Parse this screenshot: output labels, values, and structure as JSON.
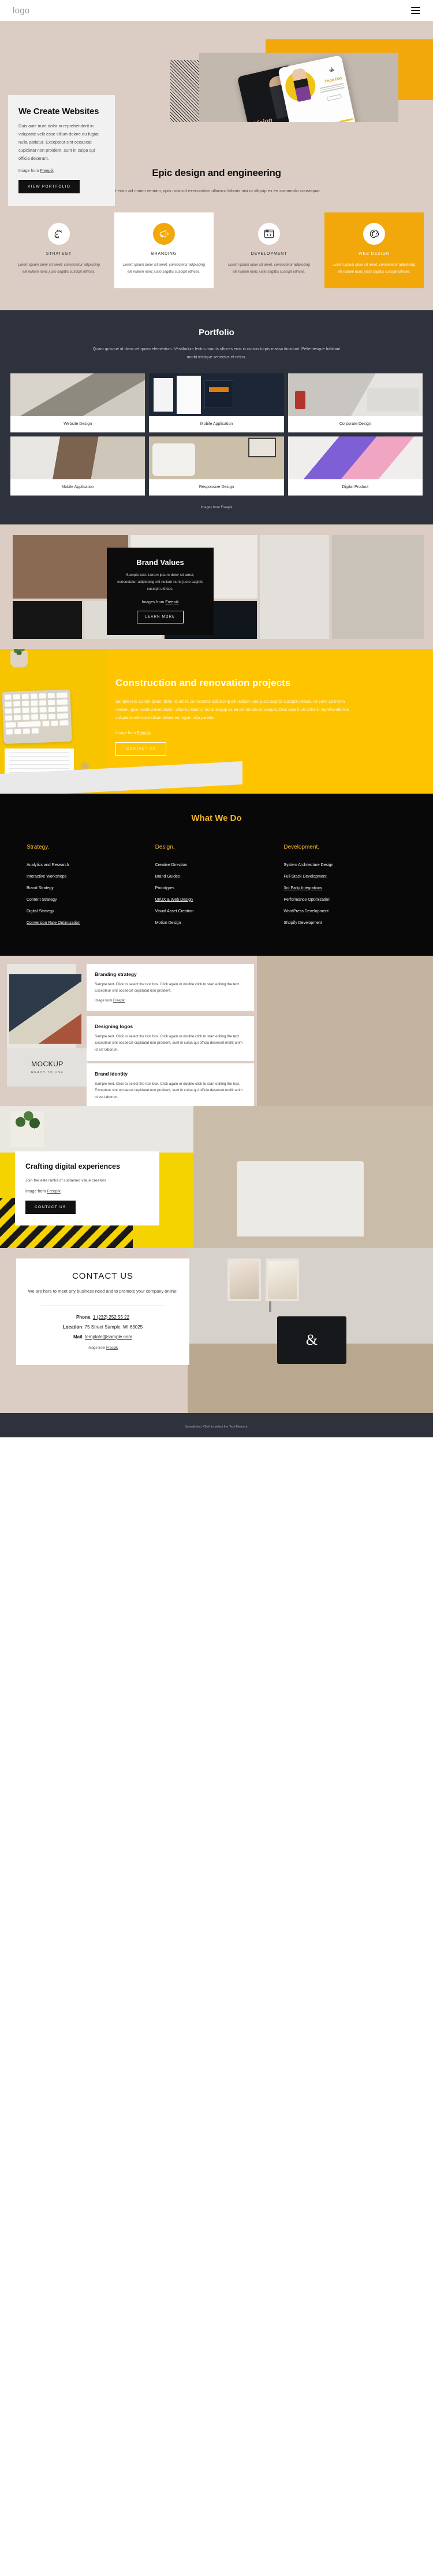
{
  "header": {
    "logo": "logo",
    "menu_icon": "hamburger-icon"
  },
  "hero": {
    "title": "We Create Websites",
    "body": "Duis aute irure dolor in reprehenderit in voluptate velit esse cillum dolore eu fugiat nulla pariatur. Excepteur sint occaecat cupidatat non proident, sunt in culpa qui officia deserunt.",
    "credit_prefix": "Image from ",
    "credit_link": "Freepik",
    "cta": "VIEW PORTFOLIO",
    "device_dark_label": "Vision",
    "device_light_label": "Yoga Day"
  },
  "epic": {
    "title": "Epic design and engineering",
    "subtitle": "Ut enim ad minim veniam, quis nostrud exercitation ullamco laboris nisi ut aliquip ex ea commodo consequat.",
    "features": [
      {
        "icon": "head-idea-icon",
        "title": "STRATEGY",
        "text": "Lorem ipsum dolor sit amet, consectetur adipiscing elit nullam nunc justo sagittis suscipit ultrices."
      },
      {
        "icon": "megaphone-icon",
        "title": "BRANDING",
        "text": "Lorem ipsum dolor sit amet, consectetur adipiscing elit nullam nunc justo sagittis suscipit ultrices."
      },
      {
        "icon": "code-window-icon",
        "title": "DEVELOPMENT",
        "text": "Lorem ipsum dolor sit amet, consectetur adipiscing elit nullam nunc justo sagittis suscipit ultrices."
      },
      {
        "icon": "palette-icon",
        "title": "WEB DESIGN",
        "text": "Lorem ipsum dolor sit amet, consectetur adipiscing elit nullam nunc justo sagittis suscipit ultrices."
      }
    ]
  },
  "portfolio": {
    "title": "Portfolio",
    "subtitle": "Quam quisque id diam vel quam elementum. Vestibulum lectus mauris ultrices eros in cursus turpis massa tincidunt. Pellentesque habitant morbi tristique senectus et netus.",
    "items": [
      {
        "label": "Website Design"
      },
      {
        "label": "Mobile Application"
      },
      {
        "label": "Corporate Design"
      },
      {
        "label": "Mobile Application"
      },
      {
        "label": "Responsive Design"
      },
      {
        "label": "Digital Product"
      }
    ],
    "credit": "Images from Freepik"
  },
  "brand_values": {
    "title": "Brand Values",
    "body": "Sample text. Lorem ipsum dolor sit amet, consectetur adipiscing elit nullam nunc justo sagittis suscipit ultrices.",
    "credit_prefix": "Images from ",
    "credit_link": "Freepik",
    "cta": "LEARN MORE"
  },
  "construction": {
    "title": "Construction and renovation projects",
    "body": "Sample text. Lorem ipsum dolor sit amet, consectetur adipiscing elit nullam nunc justo sagittis suscipit ultrices. Ut enim ad minim veniam, quis nostrud exercitation ullamco laboris nisi ut aliquip ex ea commodo consequat. Duis aute irure dolor in reprehenderit in voluptate velit esse cillum dolore eu fugiat nulla pariatur.",
    "credit_prefix": "Image from ",
    "credit_link": "Freepik",
    "cta": "CONTACT US"
  },
  "what_we_do": {
    "title": "What We Do",
    "columns": [
      {
        "heading": "Strategy.",
        "items": [
          {
            "label": "Analytics and Research",
            "underline": false
          },
          {
            "label": "Interactive Workshops",
            "underline": false
          },
          {
            "label": "Brand Strategy",
            "underline": false
          },
          {
            "label": "Content Strategy",
            "underline": false
          },
          {
            "label": "Digital Strategy",
            "underline": false
          },
          {
            "label": "Conversion Rate Optimization",
            "underline": true
          }
        ]
      },
      {
        "heading": "Design.",
        "items": [
          {
            "label": "Creative Direction",
            "underline": false
          },
          {
            "label": "Brand Guides",
            "underline": false
          },
          {
            "label": "Prototypes",
            "underline": false
          },
          {
            "label": "UI/UX & Web Design",
            "underline": true
          },
          {
            "label": "Visual Asset Creation",
            "underline": false
          },
          {
            "label": "Motion Design",
            "underline": false
          }
        ]
      },
      {
        "heading": "Development.",
        "items": [
          {
            "label": "System Architecture Design",
            "underline": false
          },
          {
            "label": "Full-Stack Development",
            "underline": false
          },
          {
            "label": "3rd Party Integrations",
            "underline": true
          },
          {
            "label": "Performance Optimization",
            "underline": false
          },
          {
            "label": "WordPress Development",
            "underline": false
          },
          {
            "label": "Shopify Development",
            "underline": false
          }
        ]
      }
    ]
  },
  "mockup": {
    "box_title": "MOCKUP",
    "box_sub": "READY TO USE",
    "cards": [
      {
        "title": "Branding strategy",
        "text": "Sample text. Click to select the text box. Click again or double click to start editing the text. Excepteur sint occaecat cupidatat non proident.",
        "credit_prefix": "Image from ",
        "credit_link": "Freepik"
      },
      {
        "title": "Designing logos",
        "text": "Sample text. Click to select the text box. Click again or double click to start editing the text. Excepteur sint occaecat cupidatat non proident, sunt in culpa qui officia deserunt mollit anim id est laborum.",
        "credit_prefix": "",
        "credit_link": ""
      },
      {
        "title": "Brand identity",
        "text": "Sample text. Click to select the text box. Click again or double click to start editing the text. Excepteur sint occaecat cupidatat non proident, sunt in culpa qui officia deserunt mollit anim id est laborum.",
        "credit_prefix": "",
        "credit_link": ""
      }
    ]
  },
  "crafting": {
    "title": "Crafting digital experiences",
    "body": "Join the elite ranks of sustained value creators",
    "credit_prefix": "Image from ",
    "credit_link": "Freepik",
    "cta": "CONTACT US"
  },
  "contact": {
    "title": "CONTACT US",
    "lead": "We are here to meet any business need and to promote your company online!",
    "phone_label": "Phone",
    "phone_value": "1 (232) 252 55 22",
    "location_label": "Location",
    "location_value": "75 Street Sample, WI 63025",
    "mail_label": "Mail",
    "mail_value": "template@sample.com",
    "credit_prefix": "Image from ",
    "credit_link": "Freepik",
    "monitor_glyph": "&"
  },
  "footer": {
    "text": "Sample text. Click to select the Text Element."
  },
  "colors": {
    "yellow": "#f2a70a",
    "bright_yellow": "#ffc400",
    "beige": "#dbcdc4",
    "dark": "#2e323c",
    "black": "#080808"
  }
}
